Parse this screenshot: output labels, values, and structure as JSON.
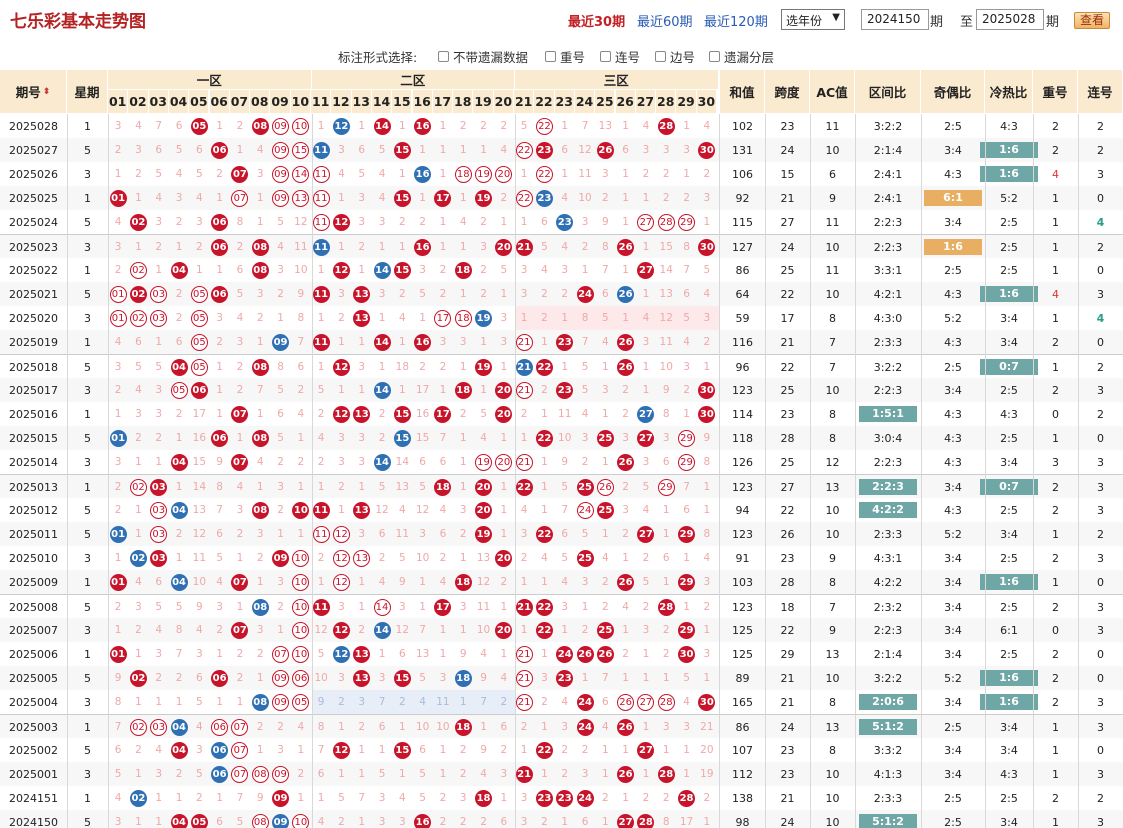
{
  "header": {
    "title": "七乐彩基本走势图",
    "nav": [
      "最近30期",
      "最近60期",
      "最近120期"
    ],
    "year_select": "选年份",
    "from": "2024150",
    "to": "2025028",
    "qi": "期",
    "zhi": "至",
    "query": "查看"
  },
  "options": {
    "label": "标注形式选择:",
    "items": [
      "不带遗漏数据",
      "重号",
      "连号",
      "边号",
      "遗漏分层"
    ]
  },
  "columns": {
    "qihao": "期号",
    "xingqi": "星期",
    "zones": [
      "一区",
      "二区",
      "三区"
    ],
    "numbers": [
      "01",
      "02",
      "03",
      "04",
      "05",
      "06",
      "07",
      "08",
      "09",
      "10",
      "11",
      "12",
      "13",
      "14",
      "15",
      "16",
      "17",
      "18",
      "19",
      "20",
      "21",
      "22",
      "23",
      "24",
      "25",
      "26",
      "27",
      "28",
      "29",
      "30"
    ],
    "stats": [
      "和值",
      "跨度",
      "AC值",
      "区间比",
      "奇偶比",
      "冷热比",
      "重号",
      "连号"
    ]
  },
  "rows": [
    {
      "q": "2025028",
      "w": "1",
      "n": [
        3,
        4,
        7,
        6,
        "r5",
        1,
        2,
        "r8",
        "o9",
        "o10",
        1,
        "b12",
        1,
        "r14",
        1,
        "r16",
        1,
        2,
        2,
        2,
        5,
        "o22",
        1,
        7,
        13,
        1,
        4,
        "r28",
        1,
        4
      ],
      "s": [
        "102",
        "23",
        "11",
        "3:2:2",
        "2:5",
        "4:3",
        "2",
        "2"
      ]
    },
    {
      "q": "2025027",
      "w": "5",
      "n": [
        2,
        3,
        6,
        5,
        6,
        "r6",
        1,
        4,
        "o9",
        "o15",
        "b11",
        3,
        6,
        5,
        "r15",
        1,
        1,
        1,
        1,
        4,
        "o22",
        "r23",
        6,
        12,
        "r26",
        6,
        3,
        3,
        3,
        "r30"
      ],
      "s": [
        "131",
        "24",
        "10",
        "2:1:4",
        "3:4",
        "1:6",
        "2",
        "2"
      ],
      "tags": {
        "lr": "teal"
      }
    },
    {
      "q": "2025026",
      "w": "3",
      "n": [
        1,
        2,
        5,
        4,
        5,
        2,
        "r7",
        3,
        "o9",
        "o14",
        "o11",
        4,
        5,
        4,
        1,
        "b16",
        1,
        "o18",
        "o19",
        "o20",
        1,
        "o22",
        1,
        11,
        3,
        1,
        2,
        2,
        1,
        2
      ],
      "s": [
        "106",
        "15",
        "6",
        "2:4:1",
        "4:3",
        "1:6",
        "4",
        "3"
      ],
      "tags": {
        "lr": "teal"
      },
      "red": [
        6
      ]
    },
    {
      "q": "2025025",
      "w": "1",
      "n": [
        "r1",
        1,
        4,
        3,
        4,
        1,
        "o7",
        1,
        "o9",
        "o13",
        "o11",
        1,
        3,
        4,
        "r15",
        1,
        "r17",
        1,
        "r19",
        2,
        "o22",
        "b23",
        4,
        10,
        2,
        1,
        1,
        2,
        2,
        3
      ],
      "s": [
        "92",
        "21",
        "9",
        "2:4:1",
        "6:1",
        "5:2",
        "1",
        "0"
      ],
      "tags": {
        "oe": "orange"
      }
    },
    {
      "q": "2025024",
      "w": "5",
      "n": [
        4,
        "r2",
        3,
        2,
        3,
        "r6",
        8,
        1,
        5,
        12,
        "o11",
        "r12",
        3,
        3,
        2,
        2,
        1,
        4,
        2,
        1,
        1,
        6,
        "b23",
        3,
        9,
        1,
        "o27",
        "o28",
        "o29",
        1
      ],
      "s": [
        "115",
        "27",
        "11",
        "2:2:3",
        "3:4",
        "2:5",
        "1",
        "4"
      ],
      "teal": [
        7
      ]
    },
    {
      "q": "2025023",
      "w": "3",
      "n": [
        3,
        1,
        2,
        1,
        2,
        "r6",
        2,
        "r8",
        4,
        11,
        "b11",
        1,
        2,
        1,
        1,
        "r16",
        1,
        1,
        3,
        "r20",
        "r21",
        5,
        4,
        2,
        8,
        "r26",
        1,
        15,
        8,
        "r30"
      ],
      "s": [
        "127",
        "24",
        "10",
        "2:2:3",
        "1:6",
        "2:5",
        "1",
        "2"
      ],
      "tags": {
        "oe": "orange"
      },
      "gsep": true
    },
    {
      "q": "2025022",
      "w": "1",
      "n": [
        2,
        "o2",
        1,
        "r4",
        1,
        1,
        6,
        "r8",
        3,
        10,
        1,
        "r12",
        1,
        "b14",
        "r15",
        3,
        2,
        "r18",
        2,
        5,
        3,
        4,
        3,
        1,
        7,
        1,
        "r27",
        14,
        7,
        5
      ],
      "s": [
        "86",
        "25",
        "11",
        "3:3:1",
        "2:5",
        "2:5",
        "1",
        "0"
      ]
    },
    {
      "q": "2025021",
      "w": "5",
      "n": [
        "o1",
        "r2",
        "o3",
        2,
        "o5",
        "r6",
        5,
        3,
        2,
        9,
        "r11",
        3,
        "r13",
        3,
        2,
        5,
        2,
        1,
        2,
        1,
        3,
        2,
        2,
        "r24",
        6,
        "b26",
        1,
        13,
        6,
        4
      ],
      "s": [
        "64",
        "22",
        "10",
        "4:2:1",
        "4:3",
        "1:6",
        "4",
        "3"
      ],
      "tags": {
        "lr": "teal"
      },
      "red": [
        6
      ]
    },
    {
      "q": "2025020",
      "w": "3",
      "n": [
        "o1",
        "o2",
        "o3",
        2,
        "o5",
        3,
        4,
        2,
        1,
        8,
        1,
        2,
        "r13",
        1,
        4,
        1,
        "o17",
        "o18",
        "b19",
        3,
        1,
        2,
        1,
        8,
        5,
        1,
        4,
        12,
        5,
        3
      ],
      "s": [
        "59",
        "17",
        "8",
        "4:3:0",
        "5:2",
        "3:4",
        "1",
        "4"
      ],
      "teal": [
        7
      ],
      "pink3": true
    },
    {
      "q": "2025019",
      "w": "1",
      "n": [
        4,
        6,
        1,
        6,
        "o5",
        2,
        3,
        1,
        "b9",
        7,
        "r11",
        1,
        1,
        "r14",
        1,
        "r16",
        3,
        3,
        1,
        3,
        "o21",
        1,
        "r23",
        7,
        4,
        "r26",
        3,
        11,
        4,
        2
      ],
      "s": [
        "116",
        "21",
        "7",
        "2:3:3",
        "4:3",
        "3:4",
        "2",
        "0"
      ]
    },
    {
      "q": "2025018",
      "w": "5",
      "n": [
        3,
        5,
        5,
        "r4",
        "o5",
        1,
        2,
        "r8",
        8,
        6,
        1,
        "r12",
        3,
        1,
        18,
        2,
        2,
        1,
        "r19",
        1,
        "b21",
        "r22",
        1,
        5,
        1,
        "r26",
        1,
        10,
        3,
        1
      ],
      "s": [
        "96",
        "22",
        "7",
        "3:2:2",
        "2:5",
        "0:7",
        "1",
        "2"
      ],
      "tags": {
        "lr": "teal"
      },
      "gsep": true
    },
    {
      "q": "2025017",
      "w": "3",
      "n": [
        2,
        4,
        3,
        "o5",
        "r6",
        1,
        2,
        7,
        5,
        2,
        5,
        1,
        1,
        "b14",
        1,
        17,
        1,
        "r18",
        1,
        "r20",
        "o21",
        2,
        "r23",
        5,
        3,
        2,
        1,
        9,
        2,
        "r30"
      ],
      "s": [
        "123",
        "25",
        "10",
        "2:2:3",
        "3:4",
        "2:5",
        "2",
        "3"
      ]
    },
    {
      "q": "2025016",
      "w": "1",
      "n": [
        1,
        3,
        3,
        2,
        17,
        1,
        "r7",
        1,
        6,
        4,
        2,
        "r12",
        "r13",
        2,
        "r15",
        16,
        "r17",
        2,
        5,
        "r20",
        2,
        1,
        11,
        4,
        1,
        2,
        "b27",
        8,
        1,
        "r30"
      ],
      "s": [
        "114",
        "23",
        "8",
        "1:5:1",
        "4:3",
        "4:3",
        "0",
        "2"
      ],
      "tags": {
        "zone": "teal"
      }
    },
    {
      "q": "2025015",
      "w": "5",
      "n": [
        "b1",
        2,
        2,
        1,
        16,
        "r6",
        1,
        "r8",
        5,
        1,
        4,
        3,
        3,
        2,
        "b15",
        15,
        7,
        1,
        4,
        1,
        1,
        "r22",
        10,
        3,
        "r25",
        3,
        "r27",
        3,
        "o29",
        9
      ],
      "s": [
        "118",
        "28",
        "8",
        "3:0:4",
        "4:3",
        "2:5",
        "1",
        "0"
      ]
    },
    {
      "q": "2025014",
      "w": "3",
      "n": [
        3,
        1,
        1,
        "r4",
        15,
        9,
        "r7",
        4,
        2,
        2,
        2,
        3,
        3,
        "b14",
        14,
        6,
        6,
        1,
        "o19",
        "o20",
        "o21",
        1,
        9,
        2,
        1,
        "r26",
        3,
        6,
        "o29",
        8
      ],
      "s": [
        "126",
        "25",
        "12",
        "2:2:3",
        "4:3",
        "3:4",
        "3",
        "3"
      ]
    },
    {
      "q": "2025013",
      "w": "1",
      "n": [
        2,
        "o2",
        "r3",
        1,
        14,
        8,
        4,
        1,
        3,
        1,
        1,
        2,
        1,
        5,
        13,
        5,
        "r18",
        1,
        "r20",
        1,
        "r22",
        1,
        5,
        "r25",
        "o26",
        2,
        5,
        "o29",
        7,
        1
      ],
      "s": [
        "123",
        "27",
        "13",
        "2:2:3",
        "3:4",
        "0:7",
        "2",
        "3"
      ],
      "tags": {
        "zone": "teal",
        "lr": "teal"
      },
      "gsep": true
    },
    {
      "q": "2025012",
      "w": "5",
      "n": [
        2,
        1,
        "o3",
        "b4",
        13,
        7,
        3,
        "r8",
        2,
        "r10",
        "r11",
        1,
        "r13",
        12,
        4,
        12,
        4,
        3,
        "r20",
        1,
        4,
        1,
        7,
        "o24",
        "r25",
        3,
        4,
        1,
        6,
        1
      ],
      "s": [
        "94",
        "22",
        "10",
        "4:2:2",
        "4:3",
        "2:5",
        "2",
        "3"
      ],
      "tags": {
        "zone": "teal"
      }
    },
    {
      "q": "2025011",
      "w": "5",
      "n": [
        "b1",
        1,
        "o3",
        2,
        12,
        6,
        2,
        3,
        1,
        1,
        "o11",
        "o12",
        3,
        6,
        11,
        3,
        6,
        2,
        "r19",
        1,
        3,
        "r22",
        6,
        5,
        1,
        2,
        "r27",
        1,
        "r29",
        8
      ],
      "s": [
        "123",
        "26",
        "10",
        "2:3:3",
        "5:2",
        "3:4",
        "1",
        "2"
      ]
    },
    {
      "q": "2025010",
      "w": "3",
      "n": [
        1,
        "b2",
        "r3",
        1,
        11,
        5,
        1,
        2,
        "r9",
        "o10",
        2,
        "o12",
        "o13",
        2,
        5,
        10,
        2,
        1,
        13,
        "r20",
        2,
        4,
        5,
        "r25",
        4,
        1,
        2,
        6,
        1,
        4
      ],
      "s": [
        "91",
        "23",
        "9",
        "4:3:1",
        "3:4",
        "2:5",
        "2",
        "3"
      ]
    },
    {
      "q": "2025009",
      "w": "1",
      "n": [
        "r1",
        4,
        6,
        "b4",
        10,
        4,
        "r7",
        1,
        3,
        "o10",
        1,
        "o12",
        1,
        4,
        9,
        1,
        4,
        "r18",
        12,
        2,
        1,
        1,
        4,
        3,
        2,
        "r26",
        5,
        1,
        "r29",
        3
      ],
      "s": [
        "103",
        "28",
        "8",
        "4:2:2",
        "3:4",
        "1:6",
        "1",
        "0"
      ],
      "tags": {
        "lr": "teal"
      }
    },
    {
      "q": "2025008",
      "w": "5",
      "n": [
        2,
        3,
        5,
        5,
        9,
        3,
        1,
        "b8",
        2,
        "o10",
        "r11",
        3,
        1,
        "o14",
        3,
        1,
        "r17",
        3,
        11,
        1,
        "r21",
        "r22",
        3,
        1,
        2,
        4,
        2,
        "r28",
        1,
        2
      ],
      "s": [
        "123",
        "18",
        "7",
        "2:3:2",
        "3:4",
        "2:5",
        "2",
        "3"
      ],
      "gsep": true
    },
    {
      "q": "2025007",
      "w": "3",
      "n": [
        1,
        2,
        4,
        8,
        4,
        2,
        "r7",
        3,
        1,
        "o10",
        12,
        "r12",
        2,
        "b14",
        12,
        7,
        1,
        1,
        10,
        "r20",
        1,
        "r22",
        1,
        2,
        "r25",
        1,
        3,
        2,
        "r29",
        1
      ],
      "s": [
        "125",
        "22",
        "9",
        "2:2:3",
        "3:4",
        "6:1",
        "0",
        "3"
      ]
    },
    {
      "q": "2025006",
      "w": "1",
      "n": [
        "r1",
        1,
        3,
        7,
        3,
        1,
        2,
        2,
        "o7",
        "o10",
        5,
        "b12",
        "r13",
        1,
        6,
        13,
        1,
        9,
        4,
        1,
        "o21",
        1,
        "r24",
        "r26",
        "r26",
        2,
        1,
        2,
        "r30",
        3
      ],
      "s": [
        "125",
        "29",
        "13",
        "2:1:4",
        "3:4",
        "2:5",
        "2",
        "0"
      ]
    },
    {
      "q": "2025005",
      "w": "5",
      "n": [
        9,
        "r2",
        2,
        2,
        6,
        "r6",
        2,
        1,
        "o9",
        "o6",
        10,
        3,
        "r13",
        3,
        "r15",
        5,
        3,
        "b18",
        9,
        4,
        "o21",
        3,
        "r23",
        1,
        7,
        1,
        1,
        1,
        5,
        1
      ],
      "s": [
        "89",
        "21",
        "10",
        "3:2:2",
        "5:2",
        "1:6",
        "2",
        "0"
      ],
      "tags": {
        "lr": "teal"
      }
    },
    {
      "q": "2025004",
      "w": "3",
      "n": [
        8,
        1,
        1,
        1,
        5,
        1,
        1,
        "b8",
        "o9",
        "o5",
        9,
        2,
        3,
        7,
        2,
        4,
        11,
        1,
        7,
        2,
        "o21",
        2,
        4,
        "r24",
        6,
        "o26",
        "o27",
        "o28",
        4,
        "r30"
      ],
      "s": [
        "165",
        "21",
        "8",
        "2:0:6",
        "3:4",
        "1:6",
        "2",
        "3"
      ],
      "tags": {
        "zone": "teal",
        "lr": "teal"
      },
      "blue2": true
    },
    {
      "q": "2025003",
      "w": "1",
      "n": [
        7,
        "o2",
        "o3",
        "b4",
        4,
        "o6",
        "o7",
        2,
        2,
        4,
        8,
        1,
        2,
        6,
        1,
        10,
        10,
        "r18",
        1,
        6,
        2,
        1,
        3,
        "r24",
        4,
        "r26",
        1,
        3,
        3,
        21
      ],
      "s": [
        "86",
        "24",
        "13",
        "5:1:2",
        "2:5",
        "3:4",
        "1",
        "3"
      ],
      "tags": {
        "zone": "teal"
      },
      "gsep": true
    },
    {
      "q": "2025002",
      "w": "5",
      "n": [
        6,
        2,
        4,
        "r4",
        3,
        "b6",
        "o7",
        1,
        3,
        1,
        7,
        "r12",
        1,
        1,
        "r15",
        6,
        1,
        2,
        9,
        2,
        1,
        "r22",
        2,
        2,
        1,
        1,
        "r27",
        1,
        1,
        20
      ],
      "s": [
        "107",
        "23",
        "8",
        "3:3:2",
        "3:4",
        "3:4",
        "1",
        "0"
      ]
    },
    {
      "q": "2025001",
      "w": "3",
      "n": [
        5,
        1,
        3,
        2,
        5,
        "b6",
        "o7",
        "o8",
        "o9",
        2,
        6,
        1,
        1,
        5,
        1,
        5,
        1,
        2,
        4,
        3,
        "r21",
        1,
        2,
        3,
        1,
        "r26",
        1,
        "r28",
        1,
        19
      ],
      "s": [
        "112",
        "23",
        "10",
        "4:1:3",
        "3:4",
        "4:3",
        "1",
        "3"
      ]
    },
    {
      "q": "2024151",
      "w": "1",
      "n": [
        4,
        "b2",
        1,
        1,
        2,
        1,
        7,
        9,
        "r9",
        1,
        1,
        5,
        7,
        3,
        4,
        5,
        2,
        3,
        "r18",
        1,
        3,
        "r23",
        "r23",
        "r24",
        2,
        1,
        2,
        2,
        "r28",
        2
      ],
      "s": [
        "138",
        "21",
        "10",
        "2:3:3",
        "2:5",
        "2:5",
        "2",
        "2"
      ]
    },
    {
      "q": "2024150",
      "w": "5",
      "n": [
        3,
        1,
        1,
        "r4",
        "r5",
        6,
        5,
        "o8",
        "b9",
        "o10",
        4,
        2,
        1,
        3,
        3,
        "r16",
        2,
        2,
        2,
        6,
        3,
        2,
        1,
        6,
        1,
        "r27",
        "r28",
        8,
        17,
        1
      ],
      "s": [
        "98",
        "24",
        "10",
        "5:1:2",
        "2:5",
        "3:4",
        "1",
        "3"
      ],
      "tags": {
        "zone": "teal"
      }
    }
  ]
}
